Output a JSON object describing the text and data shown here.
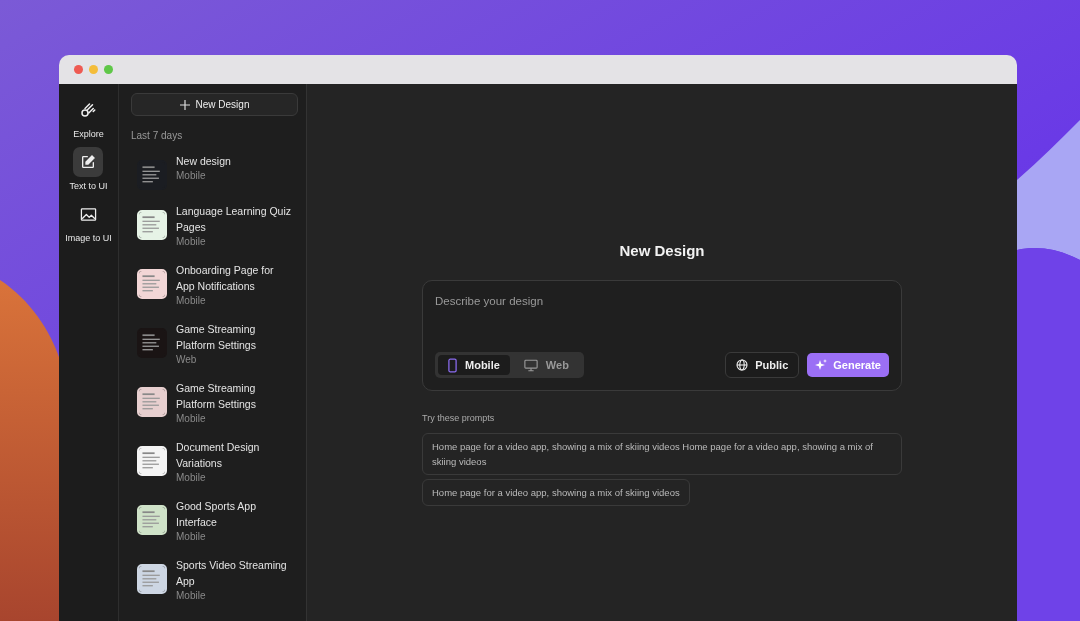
{
  "rail": [
    {
      "label": "Explore",
      "kind": "comet",
      "selected": false
    },
    {
      "label": "Text to UI",
      "kind": "edit",
      "selected": true
    },
    {
      "label": "Image to UI",
      "kind": "image",
      "selected": false
    }
  ],
  "new_design_button": "New Design",
  "history": {
    "heading": "Last 7 days",
    "items": [
      {
        "title": "New design",
        "platform": "Mobile",
        "color": "#1b1d22"
      },
      {
        "title": "Language Learning Quiz Pages",
        "platform": "Mobile",
        "color": "#e6f3e6"
      },
      {
        "title": "Onboarding Page for App Notifications",
        "platform": "Mobile",
        "color": "#f2d6d6"
      },
      {
        "title": "Game Streaming Platform Settings",
        "platform": "Web",
        "color": "#1a1414"
      },
      {
        "title": "Game Streaming Platform Settings",
        "platform": "Mobile",
        "color": "#e7cfcf"
      },
      {
        "title": "Document Design Variations",
        "platform": "Mobile",
        "color": "#f4f4f4"
      },
      {
        "title": "Good Sports App Interface",
        "platform": "Mobile",
        "color": "#cfe2c8"
      },
      {
        "title": "Sports Video Streaming App",
        "platform": "Mobile",
        "color": "#cdd6e3"
      }
    ]
  },
  "main": {
    "title": "New Design",
    "composer": {
      "placeholder": "Describe your design",
      "modes": [
        {
          "label": "Mobile",
          "kind": "phone",
          "selected": true
        },
        {
          "label": "Web",
          "kind": "monitor",
          "selected": false
        }
      ],
      "visibility": "Public",
      "generate": "Generate"
    },
    "prompts_heading": "Try these prompts",
    "prompts": [
      "Home page for a video app, showing a mix of skiing videos Home page for a video app, showing a mix of skiing videos",
      "Home page for a video app, showing a mix of skiing videos"
    ]
  }
}
